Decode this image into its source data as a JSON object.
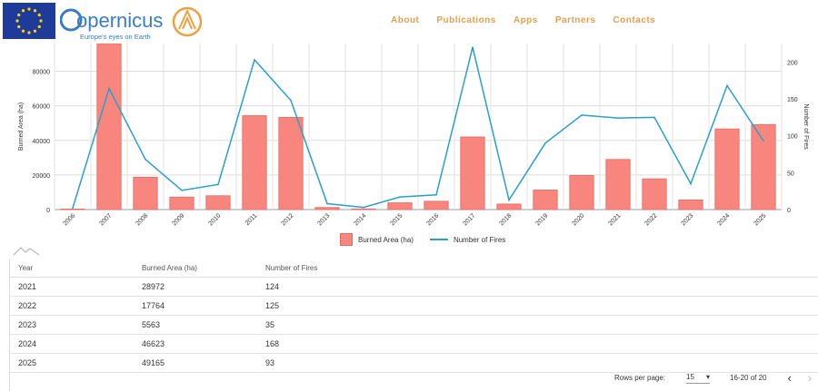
{
  "header": {
    "logo_text": "opernicus",
    "logo_tagline": "Europe's eyes on Earth",
    "nav": [
      "About",
      "Publications",
      "Apps",
      "Partners",
      "Contacts"
    ]
  },
  "colors": {
    "bar": "#f9867e",
    "bar_border": "#e56a62",
    "line": "#2aa0c9",
    "nav": "#e0a050"
  },
  "chart_data": {
    "type": "bar",
    "categories": [
      "2006",
      "2007",
      "2008",
      "2009",
      "2010",
      "2011",
      "2012",
      "2013",
      "2014",
      "2015",
      "2016",
      "2017",
      "2018",
      "2019",
      "2020",
      "2021",
      "2022",
      "2023",
      "2024",
      "2025"
    ],
    "series": [
      {
        "name": "Burned Area (ha)",
        "type": "bar",
        "axis": "left",
        "values": [
          300,
          96000,
          18700,
          7200,
          8000,
          54300,
          53300,
          1200,
          400,
          3900,
          4800,
          42000,
          3200,
          11300,
          19700,
          28972,
          17764,
          5563,
          46623,
          49165
        ]
      },
      {
        "name": "Number of Fires",
        "type": "line",
        "axis": "right",
        "values": [
          2,
          164,
          68,
          26,
          34,
          203,
          148,
          8,
          3,
          17,
          20,
          220,
          13,
          90,
          128,
          124,
          125,
          35,
          168,
          93
        ]
      }
    ],
    "ylabel": "Burned Area (ha)",
    "y2label": "Number of Fires",
    "ylim": [
      0,
      96000
    ],
    "y2lim": [
      0,
      225
    ],
    "yticks": [
      0,
      20000,
      40000,
      60000,
      80000
    ],
    "y2ticks": [
      0,
      50,
      100,
      150,
      200
    ],
    "grid": true,
    "legend": "bottom-center"
  },
  "table": {
    "headers": [
      "Year",
      "Burned Area (ha)",
      "Number of Fires"
    ],
    "rows": [
      [
        "2021",
        "28972",
        "124"
      ],
      [
        "2022",
        "17764",
        "125"
      ],
      [
        "2023",
        "5563",
        "35"
      ],
      [
        "2024",
        "46623",
        "168"
      ],
      [
        "2025",
        "49165",
        "93"
      ]
    ]
  },
  "pagination": {
    "rows_per_page_label": "Rows per page:",
    "rows_per_page": "15",
    "range": "16-20 of 20"
  }
}
